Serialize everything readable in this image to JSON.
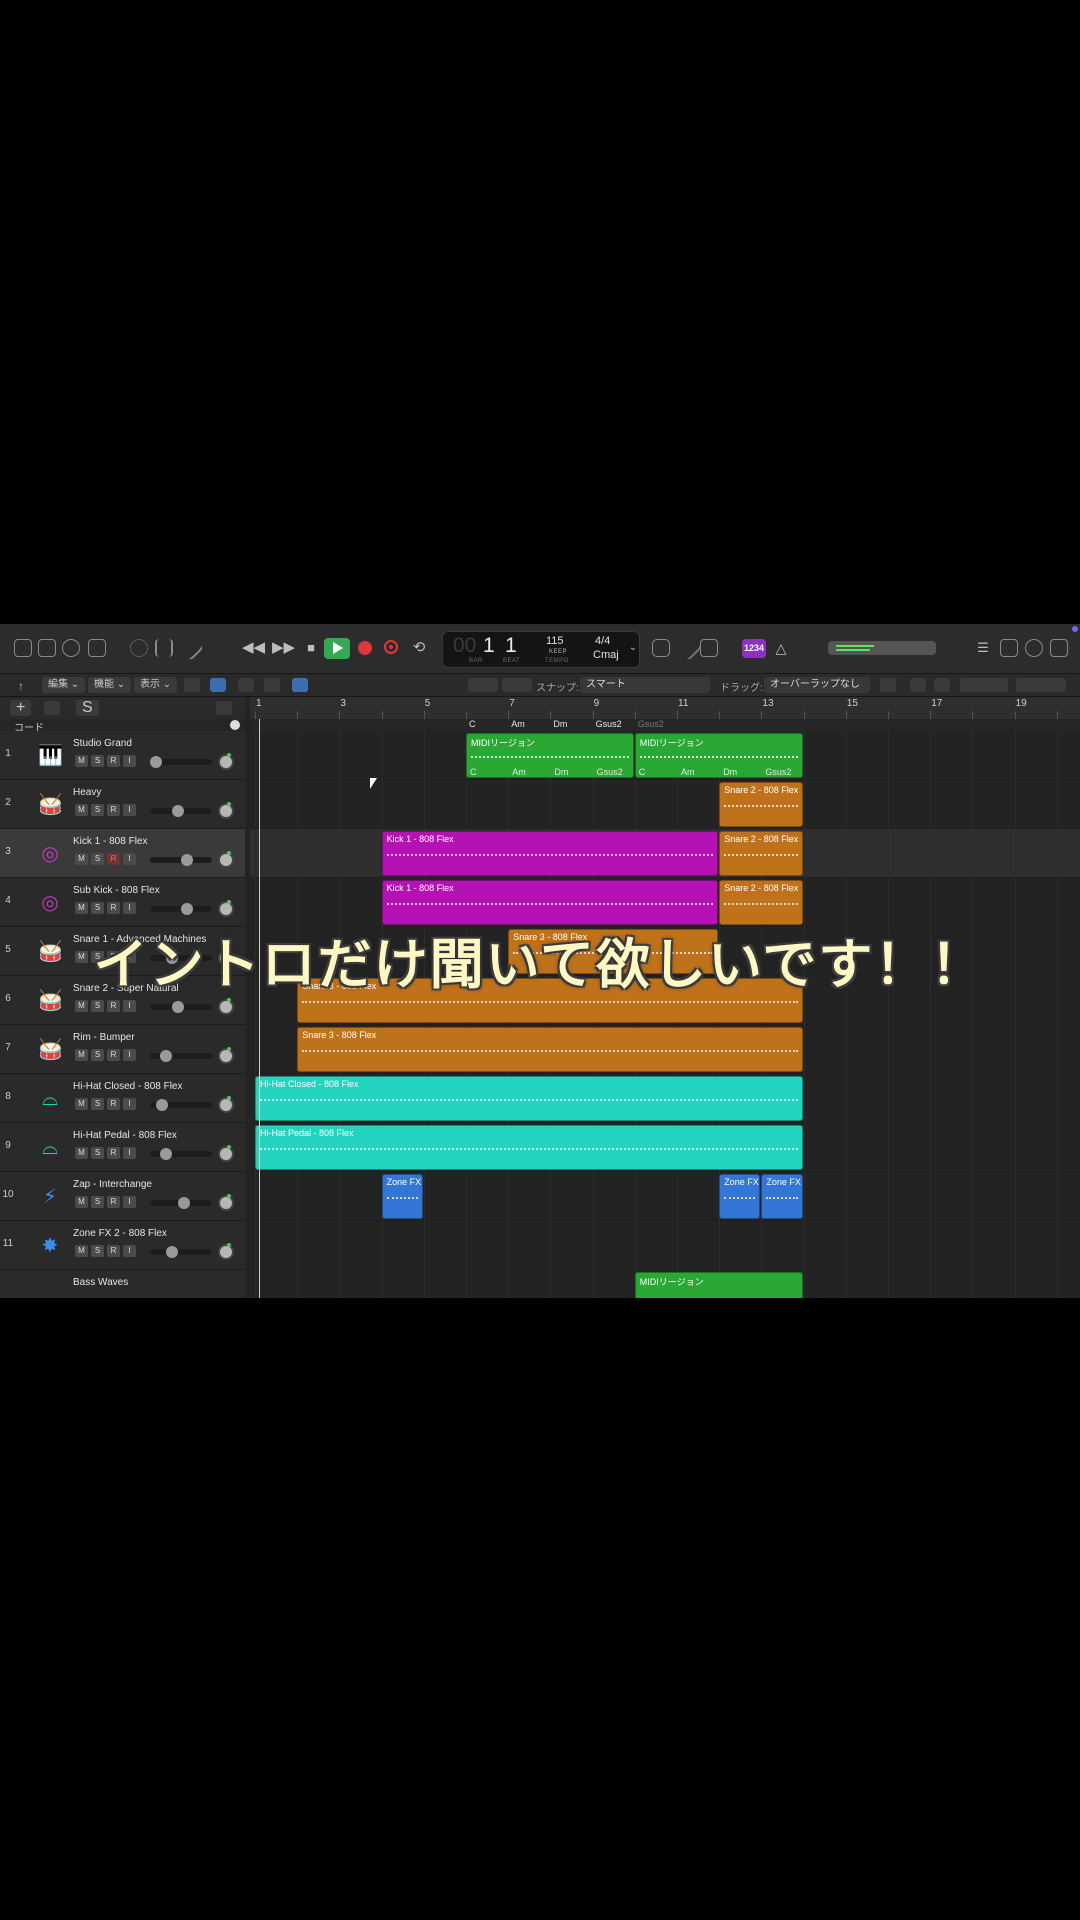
{
  "overlay": {
    "caption": "イントロだけ聞いて欲しいです！！"
  },
  "transport": {
    "bar_dim": "00",
    "bar": "1",
    "beat": "1",
    "bar_label": "BAR",
    "beat_label": "BEAT",
    "tempo": "115",
    "tempo_sub": "KEEP",
    "tempo_label": "TEMPO",
    "signature": "4/4",
    "key": "Cmaj",
    "count_in_badge": "1234"
  },
  "toolbar": {
    "edit_menu": "編集",
    "functions_menu": "機能",
    "view_menu": "表示",
    "snap_label": "スナップ:",
    "snap_value": "スマート",
    "drag_label": "ドラッグ:",
    "drag_value": "オーバーラップなし"
  },
  "header": {
    "add_button": "+",
    "solo_button": "S",
    "chord_track_label": "コード"
  },
  "ruler": {
    "bars": [
      "1",
      "3",
      "5",
      "7",
      "9",
      "11",
      "13",
      "15",
      "17",
      "19"
    ]
  },
  "chords": {
    "top": [
      "C",
      "Am",
      "Dm",
      "Gsus2",
      "Gsus2"
    ],
    "inner_a": [
      "C",
      "Am",
      "Dm",
      "Gsus2"
    ],
    "inner_b": [
      "C",
      "Am",
      "Dm",
      "Gsus2"
    ]
  },
  "tracks": [
    {
      "num": "1",
      "name": "Studio Grand",
      "icon": "piano-icon",
      "glyph": "🎹",
      "color": "#2ecc40",
      "vol": 0.1
    },
    {
      "num": "2",
      "name": "Heavy",
      "icon": "drum-kit-icon",
      "glyph": "🥁",
      "color": "#2ecc40",
      "vol": 0.45
    },
    {
      "num": "3",
      "name": "Kick 1 - 808 Flex",
      "icon": "kick-drum-icon",
      "glyph": "◎",
      "color": "#c239c2",
      "vol": 0.6,
      "selected": true
    },
    {
      "num": "4",
      "name": "Sub Kick - 808 Flex",
      "icon": "kick-drum-icon",
      "glyph": "◎",
      "color": "#c239c2",
      "vol": 0.6
    },
    {
      "num": "5",
      "name": "Snare 1 - Advanced Machines",
      "icon": "snare-drum-icon",
      "glyph": "🥁",
      "color": "#e08a1e",
      "vol": 0.35
    },
    {
      "num": "6",
      "name": "Snare 2 - Super Natural",
      "icon": "snare-drum-icon",
      "glyph": "🥁",
      "color": "#e08a1e",
      "vol": 0.45
    },
    {
      "num": "7",
      "name": "Rim - Bumper",
      "icon": "snare-drum-icon",
      "glyph": "🥁",
      "color": "#e08a1e",
      "vol": 0.25
    },
    {
      "num": "8",
      "name": "Hi-Hat Closed - 808 Flex",
      "icon": "hi-hat-icon",
      "glyph": "⌓",
      "color": "#21d3bf",
      "vol": 0.2
    },
    {
      "num": "9",
      "name": "Hi-Hat Pedal - 808 Flex",
      "icon": "hi-hat-icon",
      "glyph": "⌓",
      "color": "#21d3bf",
      "vol": 0.25
    },
    {
      "num": "10",
      "name": "Zap - Interchange",
      "icon": "lightning-icon",
      "glyph": "⚡",
      "color": "#3a8ee6",
      "vol": 0.55
    },
    {
      "num": "11",
      "name": "Zone FX 2 - 808 Flex",
      "icon": "burst-icon",
      "glyph": "✸",
      "color": "#3a8ee6",
      "vol": 0.35
    },
    {
      "num": "",
      "name": "Bass Waves",
      "icon": "bass-icon",
      "glyph": "",
      "color": "#2ecc40",
      "vol": 0.4
    }
  ],
  "regions": [
    {
      "track": 0,
      "start": 6,
      "end": 10,
      "label": "MIDIリージョン",
      "color": "#2aa834"
    },
    {
      "track": 0,
      "start": 10,
      "end": 14,
      "label": "MIDIリージョン",
      "color": "#2aa834"
    },
    {
      "track": 1,
      "start": 12,
      "end": 14,
      "label": "Snare 2 - 808 Flex",
      "color": "#c0721b"
    },
    {
      "track": 2,
      "start": 4,
      "end": 12,
      "label": "Kick 1 - 808 Flex",
      "color": "#b511b5"
    },
    {
      "track": 2,
      "start": 12,
      "end": 14,
      "label": "Snare 2 - 808 Flex",
      "color": "#c0721b"
    },
    {
      "track": 3,
      "start": 4,
      "end": 12,
      "label": "Kick 1 - 808 Flex",
      "color": "#b511b5"
    },
    {
      "track": 3,
      "start": 12,
      "end": 14,
      "label": "Snare 2 - 808 Flex",
      "color": "#c0721b"
    },
    {
      "track": 4,
      "start": 7,
      "end": 12,
      "label": "Snare 3 - 808 Flex",
      "color": "#c0721b"
    },
    {
      "track": 5,
      "start": 2,
      "end": 14,
      "label": "Snare 3 - 808 Flex",
      "color": "#c0721b"
    },
    {
      "track": 6,
      "start": 2,
      "end": 14,
      "label": "Snare 3 - 808 Flex",
      "color": "#c0721b"
    },
    {
      "track": 7,
      "start": 1,
      "end": 14,
      "label": "Hi-Hat Closed - 808 Flex",
      "color": "#22d4bf"
    },
    {
      "track": 8,
      "start": 1,
      "end": 14,
      "label": "Hi-Hat Pedal - 808 Flex",
      "color": "#22d4bf"
    },
    {
      "track": 9,
      "start": 4,
      "end": 5,
      "label": "Zone FX",
      "color": "#3476d6"
    },
    {
      "track": 9,
      "start": 12,
      "end": 13,
      "label": "Zone FX",
      "color": "#3476d6"
    },
    {
      "track": 9,
      "start": 13,
      "end": 14,
      "label": "Zone FX",
      "color": "#3476d6"
    },
    {
      "track": 11,
      "start": 10,
      "end": 14,
      "label": "MIDIリージョン",
      "color": "#2aa834"
    }
  ]
}
